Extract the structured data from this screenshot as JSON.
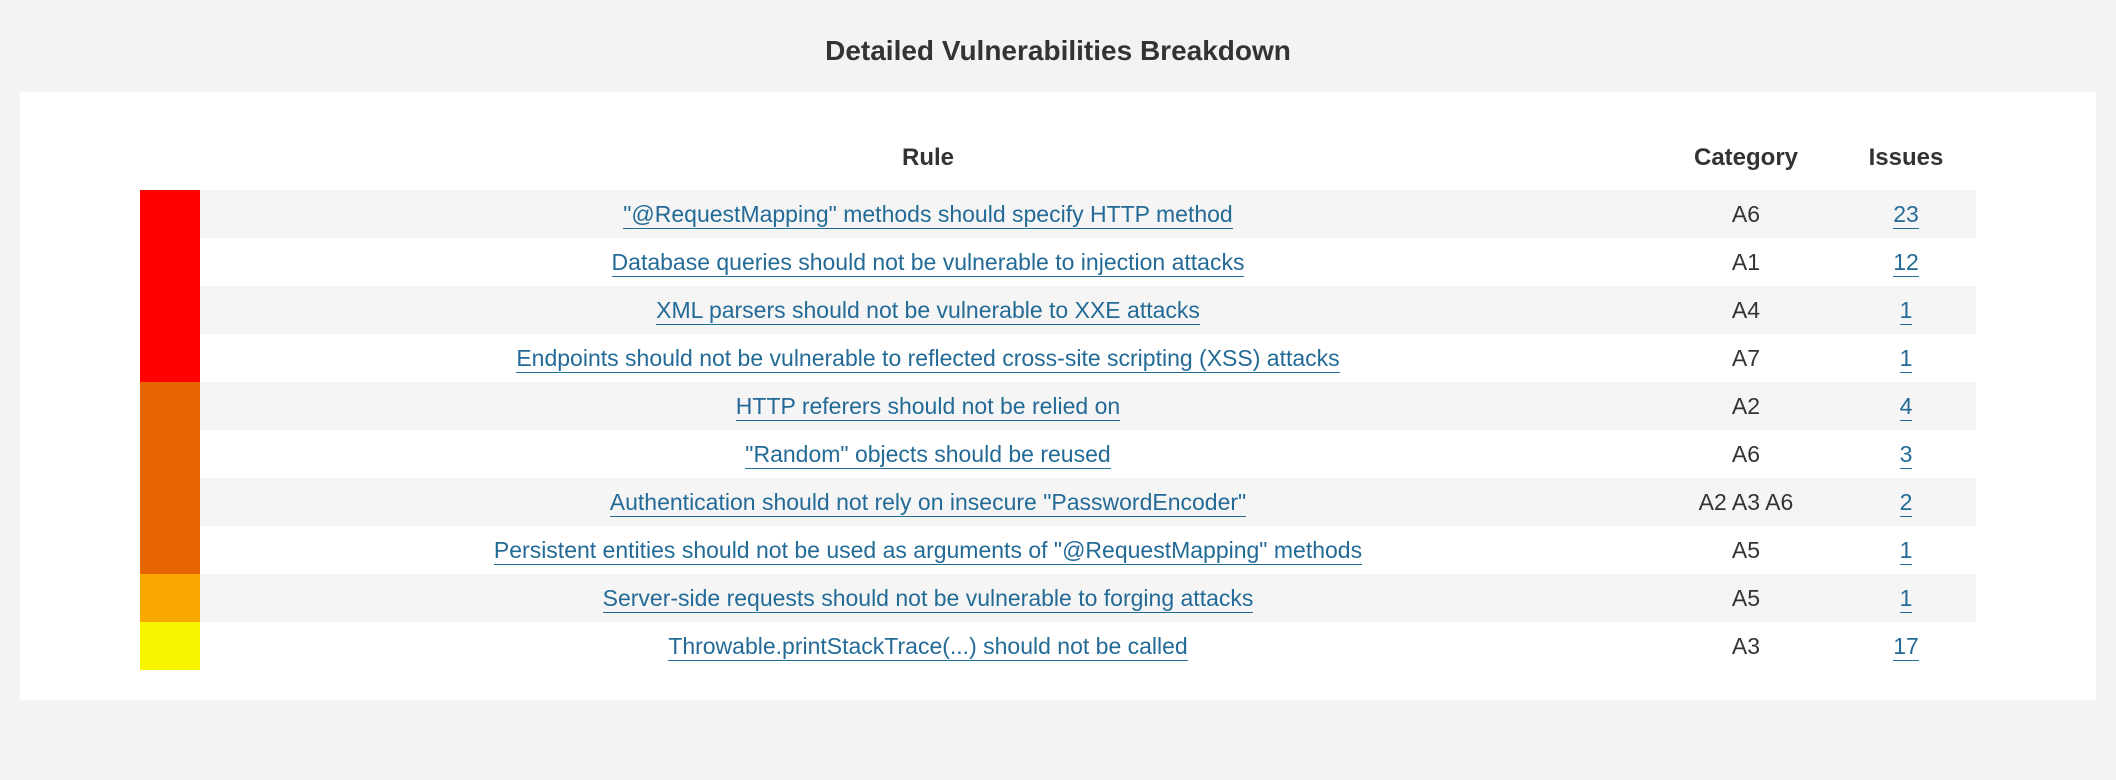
{
  "title": "Detailed Vulnerabilities Breakdown",
  "columns": {
    "rule": "Rule",
    "category": "Category",
    "issues": "Issues"
  },
  "severity_colors": {
    "blocker": "#ff0000",
    "critical": "#e76500",
    "major": "#f9a800",
    "minor": "#f7f500"
  },
  "rows": [
    {
      "severity": "blocker",
      "rule": "\"@RequestMapping\" methods should specify HTTP method",
      "category": "A6",
      "issues": 23
    },
    {
      "severity": "blocker",
      "rule": "Database queries should not be vulnerable to injection attacks",
      "category": "A1",
      "issues": 12
    },
    {
      "severity": "blocker",
      "rule": "XML parsers should not be vulnerable to XXE attacks",
      "category": "A4",
      "issues": 1
    },
    {
      "severity": "blocker",
      "rule": "Endpoints should not be vulnerable to reflected cross-site scripting (XSS) attacks",
      "category": "A7",
      "issues": 1
    },
    {
      "severity": "critical",
      "rule": "HTTP referers should not be relied on",
      "category": "A2",
      "issues": 4
    },
    {
      "severity": "critical",
      "rule": "\"Random\" objects should be reused",
      "category": "A6",
      "issues": 3
    },
    {
      "severity": "critical",
      "rule": "Authentication should not rely on insecure \"PasswordEncoder\"",
      "category": "A2 A3 A6",
      "issues": 2
    },
    {
      "severity": "critical",
      "rule": "Persistent entities should not be used as arguments of \"@RequestMapping\" methods",
      "category": "A5",
      "issues": 1
    },
    {
      "severity": "major",
      "rule": "Server-side requests should not be vulnerable to forging attacks",
      "category": "A5",
      "issues": 1
    },
    {
      "severity": "minor",
      "rule": "Throwable.printStackTrace(...) should not be called",
      "category": "A3",
      "issues": 17
    }
  ]
}
